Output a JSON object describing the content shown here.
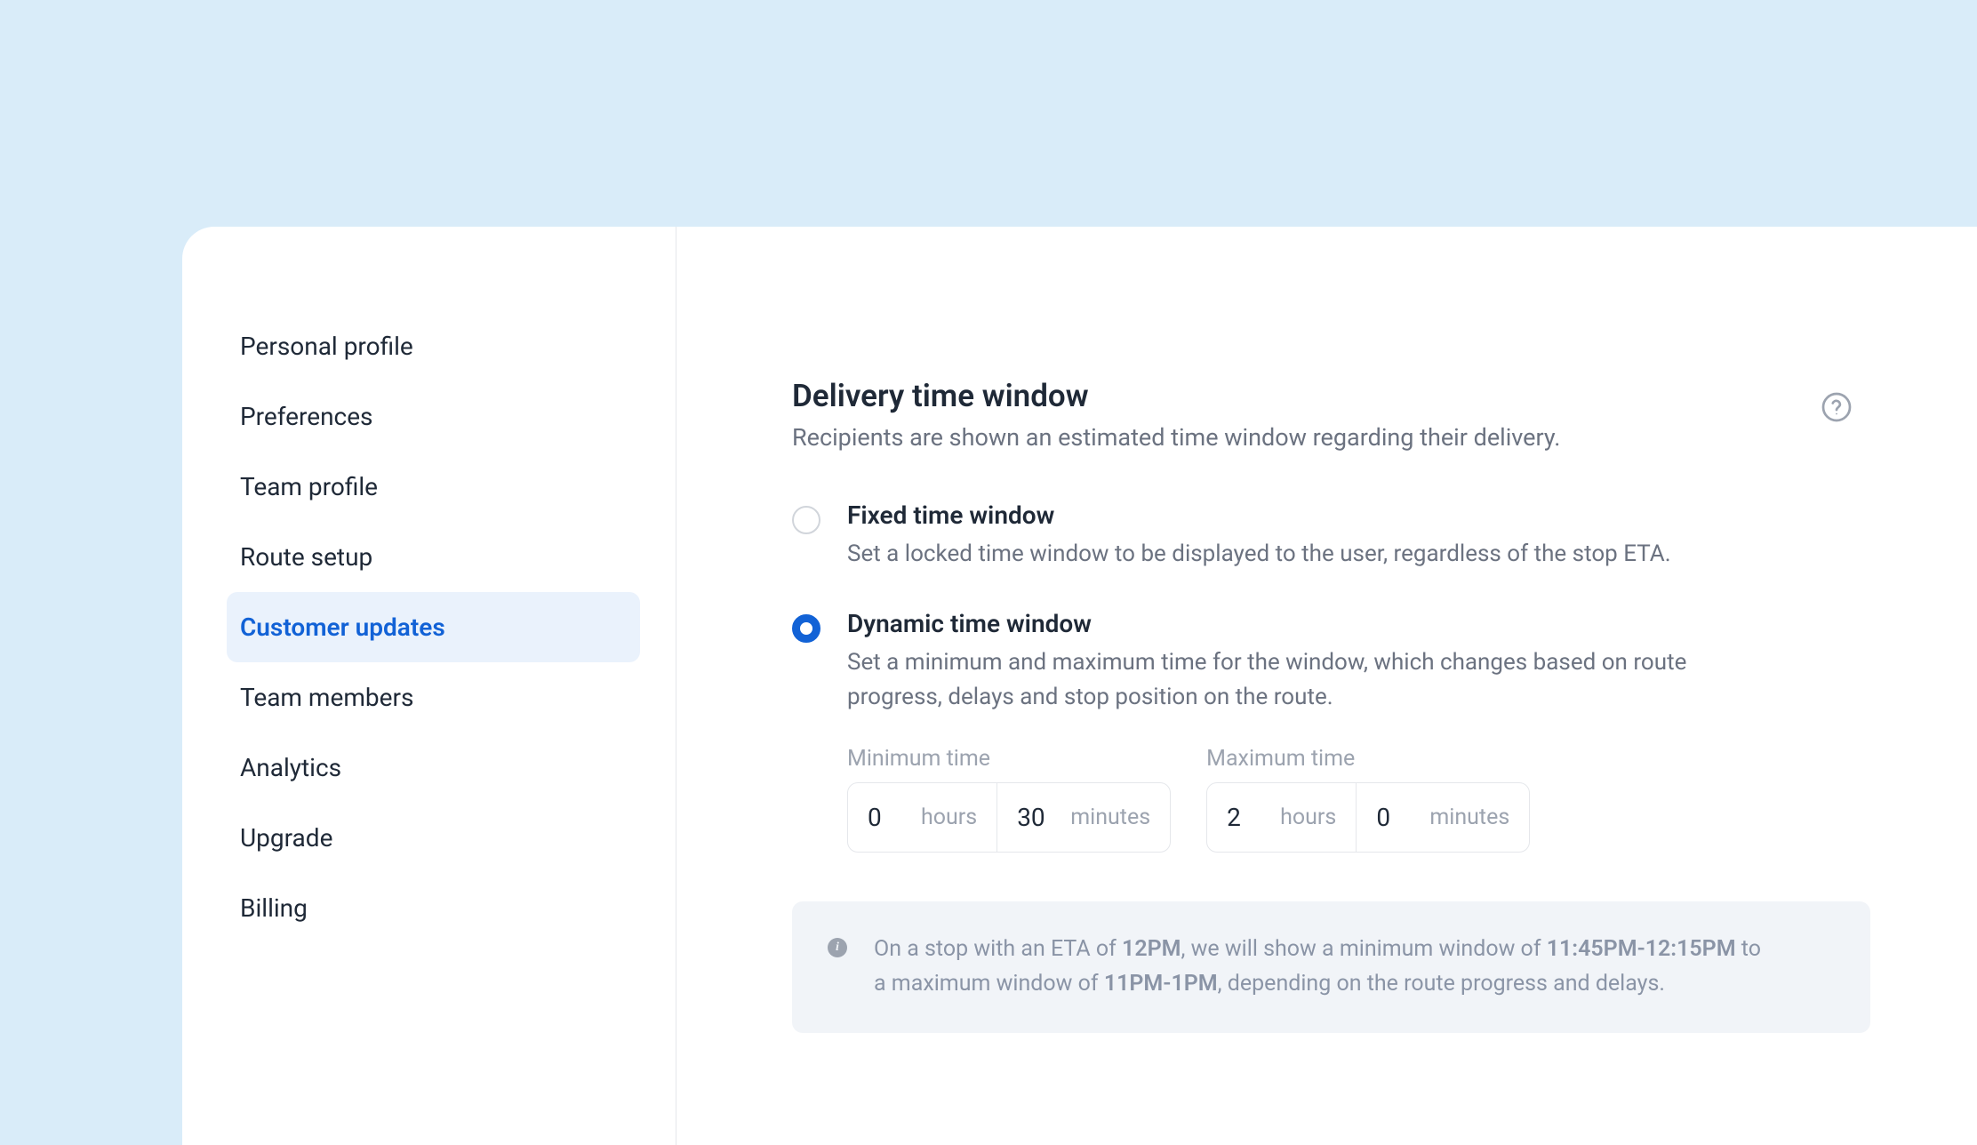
{
  "sidebar": {
    "items": [
      {
        "label": "Personal profile"
      },
      {
        "label": "Preferences"
      },
      {
        "label": "Team profile"
      },
      {
        "label": "Route setup"
      },
      {
        "label": "Customer updates"
      },
      {
        "label": "Team members"
      },
      {
        "label": "Analytics"
      },
      {
        "label": "Upgrade"
      },
      {
        "label": "Billing"
      }
    ],
    "active_index": 4
  },
  "section": {
    "title": "Delivery time window",
    "subtitle": "Recipients are shown an estimated time window regarding their delivery."
  },
  "options": {
    "fixed": {
      "title": "Fixed time window",
      "description": "Set a locked time window to be displayed to the user, regardless of the stop ETA."
    },
    "dynamic": {
      "title": "Dynamic time window",
      "description": "Set a minimum and maximum time for the window, which changes based on route progress, delays and stop position on the route."
    },
    "selected": "dynamic"
  },
  "time": {
    "min_label": "Minimum time",
    "max_label": "Maximum time",
    "hours_unit": "hours",
    "minutes_unit": "minutes",
    "min_hours": "0",
    "min_minutes": "30",
    "max_hours": "2",
    "max_minutes": "0"
  },
  "info": {
    "prefix": "On a stop with an ETA of ",
    "eta": "12PM",
    "mid1": ", we will show a minimum window of ",
    "range1": "11:45PM-12:15PM",
    "mid2": " to a maximum window of ",
    "range2": "11PM-1PM",
    "suffix": ", depending on the route progress and delays."
  }
}
